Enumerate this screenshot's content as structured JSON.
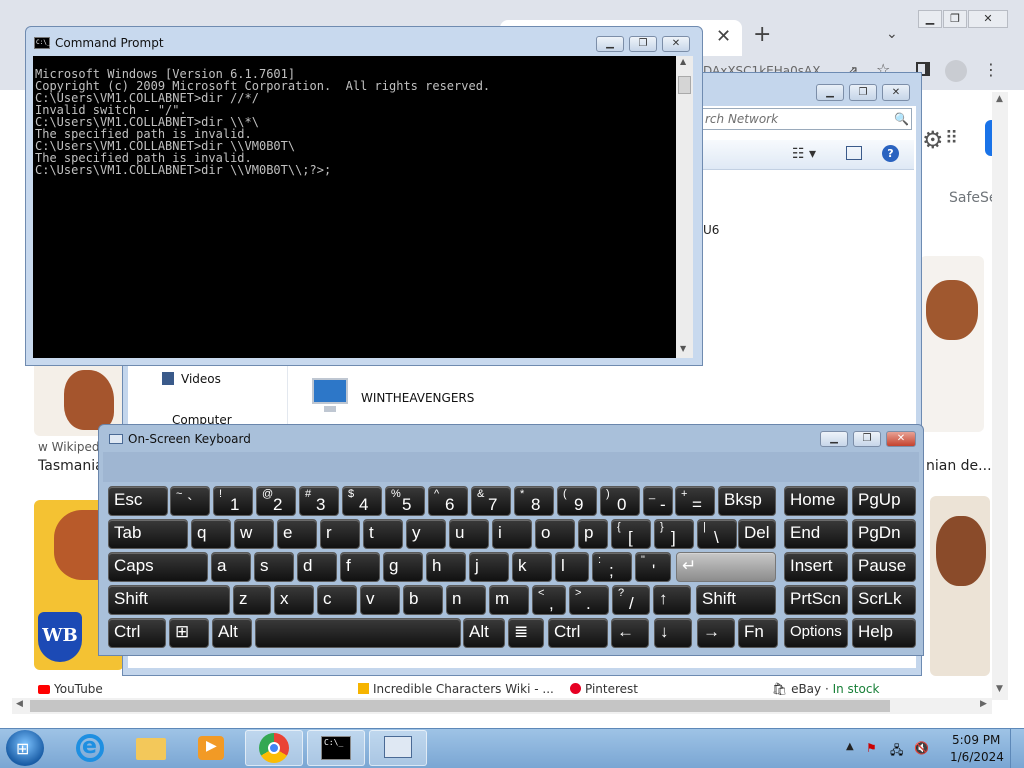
{
  "browser": {
    "url_fragment": "DAxXSC1kEHa0sAX",
    "safesearch": "SafeSe",
    "results": {
      "wiki_source": "Wikiped",
      "wiki_title": "Tasmania",
      "right_title": "nian de...",
      "links": [
        {
          "label": "YouTube"
        },
        {
          "label": "Incredible Characters Wiki - ..."
        },
        {
          "label": "Pinterest"
        },
        {
          "label": "eBay",
          "extra": "In stock",
          "separator": " · "
        }
      ],
      "wb_logo": "WB"
    }
  },
  "explorer": {
    "search_placeholder": "rch Network",
    "item_u6": "U6",
    "nav": {
      "videos": "Videos",
      "computer": "Computer"
    },
    "network_item": "WINTHEAVENGERS"
  },
  "cmd": {
    "title": "Command Prompt",
    "icon_text": "C:\\_",
    "lines": [
      "Microsoft Windows [Version 6.1.7601]",
      "Copyright (c) 2009 Microsoft Corporation.  All rights reserved.",
      "",
      "C:\\Users\\VM1.COLLABNET>dir //*/",
      "Invalid switch - \"/\".",
      "",
      "C:\\Users\\VM1.COLLABNET>dir \\\\*\\",
      "The specified path is invalid.",
      "",
      "C:\\Users\\VM1.COLLABNET>dir \\\\VM0B0T\\",
      "The specified path is invalid.",
      "",
      "C:\\Users\\VM1.COLLABNET>dir \\\\VM0B0T\\\\;?>;"
    ]
  },
  "osk": {
    "title": "On-Screen Keyboard",
    "rows": [
      [
        {
          "main": "Esc"
        },
        {
          "sup": "~",
          "sub": "`"
        },
        {
          "sup": "!",
          "sub": "1"
        },
        {
          "sup": "@",
          "sub": "2"
        },
        {
          "sup": "#",
          "sub": "3"
        },
        {
          "sup": "$",
          "sub": "4"
        },
        {
          "sup": "%",
          "sub": "5"
        },
        {
          "sup": "^",
          "sub": "6"
        },
        {
          "sup": "&",
          "sub": "7"
        },
        {
          "sup": "*",
          "sub": "8"
        },
        {
          "sup": "(",
          "sub": "9"
        },
        {
          "sup": ")",
          "sub": "0"
        },
        {
          "sup": "_",
          "sub": "-"
        },
        {
          "sup": "+",
          "sub": "="
        },
        {
          "main": "Bksp"
        },
        {
          "main": "Home"
        },
        {
          "main": "PgUp"
        }
      ],
      [
        {
          "main": "Tab"
        },
        {
          "main": "q"
        },
        {
          "main": "w"
        },
        {
          "main": "e"
        },
        {
          "main": "r"
        },
        {
          "main": "t"
        },
        {
          "main": "y"
        },
        {
          "main": "u"
        },
        {
          "main": "i"
        },
        {
          "main": "o"
        },
        {
          "main": "p"
        },
        {
          "sup": "{",
          "sub": "["
        },
        {
          "sup": "}",
          "sub": "]"
        },
        {
          "sup": "|",
          "sub": "\\"
        },
        {
          "main": "Del"
        },
        {
          "main": "End"
        },
        {
          "main": "PgDn"
        }
      ],
      [
        {
          "main": "Caps"
        },
        {
          "main": "a"
        },
        {
          "main": "s"
        },
        {
          "main": "d"
        },
        {
          "main": "f"
        },
        {
          "main": "g"
        },
        {
          "main": "h"
        },
        {
          "main": "j"
        },
        {
          "main": "k"
        },
        {
          "main": "l"
        },
        {
          "sup": ":",
          "sub": ";"
        },
        {
          "sup": "\"",
          "sub": "'"
        },
        {
          "main": "↵"
        },
        {
          "main": "Insert"
        },
        {
          "main": "Pause"
        }
      ],
      [
        {
          "main": "Shift"
        },
        {
          "main": "z"
        },
        {
          "main": "x"
        },
        {
          "main": "c"
        },
        {
          "main": "v"
        },
        {
          "main": "b"
        },
        {
          "main": "n"
        },
        {
          "main": "m"
        },
        {
          "sup": "<",
          "sub": ","
        },
        {
          "sup": ">",
          "sub": "."
        },
        {
          "sup": "?",
          "sub": "/"
        },
        {
          "main": "↑"
        },
        {
          "main": "Shift"
        },
        {
          "main": "PrtScn"
        },
        {
          "main": "ScrLk"
        }
      ],
      [
        {
          "main": "Ctrl"
        },
        {
          "main": "⊞"
        },
        {
          "main": "Alt"
        },
        {
          "main": ""
        },
        {
          "main": "Alt"
        },
        {
          "main": "≣"
        },
        {
          "main": "Ctrl"
        },
        {
          "main": "←"
        },
        {
          "main": "↓"
        },
        {
          "main": "→"
        },
        {
          "main": "Fn"
        },
        {
          "main": "Options"
        },
        {
          "main": "Help"
        }
      ]
    ]
  },
  "taskbar": {
    "clock_time": "5:09 PM",
    "clock_date": "1/6/2024",
    "items": [
      "internet-explorer",
      "windows-explorer",
      "media-player",
      "google-chrome",
      "command-prompt",
      "on-screen-keyboard"
    ]
  },
  "colors": {
    "cmd_bg": "#000000",
    "cmd_fg": "#c0c0c0",
    "osk_frame": "#a9c0da",
    "key_bg": "#1f1f1f",
    "taskbar": "#8db6de"
  }
}
